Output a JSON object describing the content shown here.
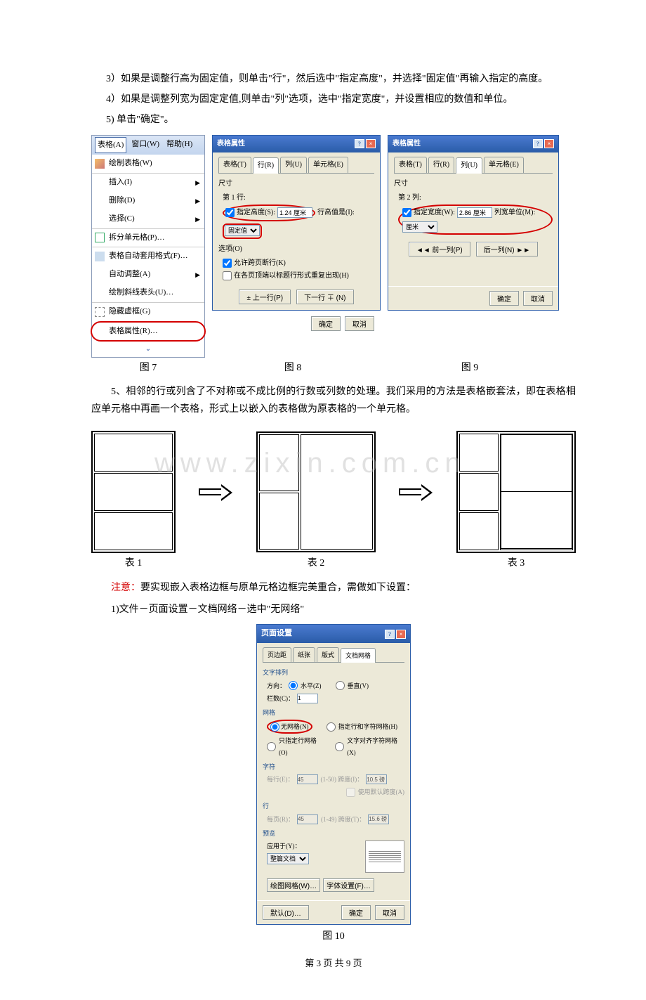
{
  "text": {
    "p1": "3）如果是调整行高为固定值，则单击\"行\"，然后选中\"指定高度\"，并选择\"固定值\"再输入指定的高度。",
    "p2": "4）如果是调整列宽为固定定值,则单击\"列\"选项，选中\"指定宽度\"，并设置相应的数值和单位。",
    "p3": "5) 单击\"确定\"。",
    "p4": "5、相邻的行或列含了不对称或不成比例的行数或列数的处理。我们采用的方法是表格嵌套法，即在表格相应单元格中再画一个表格，形式上以嵌入的表格做为原表格的一个单元格。",
    "note_label": "注意：",
    "note": "要实现嵌入表格边框与原单元格边框完美重合，需做如下设置：",
    "p5": "1)文件－页面设置－文档网络－选中\"无网络\""
  },
  "fig7": {
    "menubar": [
      "表格(A)",
      "窗口(W)",
      "帮助(H)"
    ],
    "items": [
      "绘制表格(W)",
      "插入(I)",
      "删除(D)",
      "选择(C)",
      "拆分单元格(P)…",
      "表格自动套用格式(F)…",
      "自动调整(A)",
      "绘制斜线表头(U)…",
      "隐藏虚框(G)",
      "表格属性(R)…"
    ],
    "label": "图 7"
  },
  "fig8": {
    "title": "表格属性",
    "tabs": [
      "表格(T)",
      "行(R)",
      "列(U)",
      "单元格(E)"
    ],
    "size_label": "尺寸",
    "row_label": "第 1 行:",
    "spec_h": "指定高度(S):",
    "h_val": "1.24 厘米",
    "h_is": "行高值是(I):",
    "h_type": "固定值",
    "opt_label": "选项(O)",
    "opt1": "允许跨页断行(K)",
    "opt2": "在各页顶端以标题行形式重复出现(H)",
    "prev": "± 上一行(P)",
    "next": "下一行 ∓ (N)",
    "ok": "确定",
    "cancel": "取消",
    "label": "图 8"
  },
  "fig9": {
    "title": "表格属性",
    "tabs": [
      "表格(T)",
      "行(R)",
      "列(U)",
      "单元格(E)"
    ],
    "size_label": "尺寸",
    "col_label": "第 2 列:",
    "spec_w": "指定宽度(W):",
    "w_val": "2.86 厘米",
    "w_unit_l": "列宽单位(M):",
    "w_unit": "厘米",
    "prev": "◄◄ 前一列(P)",
    "next": "后一列(N) ►►",
    "ok": "确定",
    "cancel": "取消",
    "label": "图 9"
  },
  "tables": {
    "t1": "表 1",
    "t2": "表 2",
    "t3": "表 3"
  },
  "fig10": {
    "title": "页面设置",
    "tabs": [
      "页边距",
      "纸张",
      "版式",
      "文档网格"
    ],
    "s1_t": "文字排列",
    "s1_dir": "方向：",
    "s1_h": "水平(Z)",
    "s1_v": "垂直(V)",
    "s1_cols": "栏数(C)：",
    "s1_cols_v": "1",
    "s2_t": "网格",
    "s2_none": "无网格(N)",
    "s2_line": "只指定行网格(O)",
    "s2_both": "指定行和字符网格(H)",
    "s2_align": "文字对齐字符网格(X)",
    "s3_t": "字符",
    "s3_per": "每行(E)：",
    "s3_v": "45",
    "s3_r": "(1-50) 跨度(I)：",
    "s3_w": "10.5 磅",
    "s3_def": "使用默认跨度(A)",
    "s4_t": "行",
    "s4_per": "每页(R)：",
    "s4_v": "45",
    "s4_r": "(1-49) 跨度(T)：",
    "s4_w": "15.6 磅",
    "s5_t": "预览",
    "s5_apply": "应用于(Y)：",
    "s5_apply_v": "整篇文档",
    "s5_draw": "绘图网格(W)…",
    "s5_font": "字体设置(F)…",
    "default": "默认(D)…",
    "ok": "确定",
    "cancel": "取消",
    "label": "图 10"
  },
  "footer": "第 3 页 共 9 页",
  "watermark": "www.zixin.com.cn"
}
